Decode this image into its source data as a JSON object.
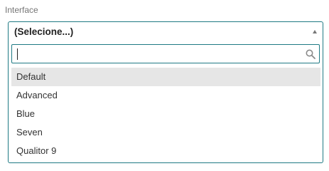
{
  "field": {
    "label": "Interface"
  },
  "select": {
    "selected_label": "(Selecione...)",
    "arrow_icon": "caret-up-icon"
  },
  "search": {
    "value": "",
    "placeholder": "",
    "icon": "search-icon"
  },
  "options": [
    {
      "label": "Default",
      "highlighted": true
    },
    {
      "label": "Advanced",
      "highlighted": false
    },
    {
      "label": "Blue",
      "highlighted": false
    },
    {
      "label": "Seven",
      "highlighted": false
    },
    {
      "label": "Qualitor 9",
      "highlighted": false
    }
  ],
  "colors": {
    "focus_border": "#1f7a84",
    "highlight_background": "#e6e6e6",
    "label_text": "#757575"
  }
}
